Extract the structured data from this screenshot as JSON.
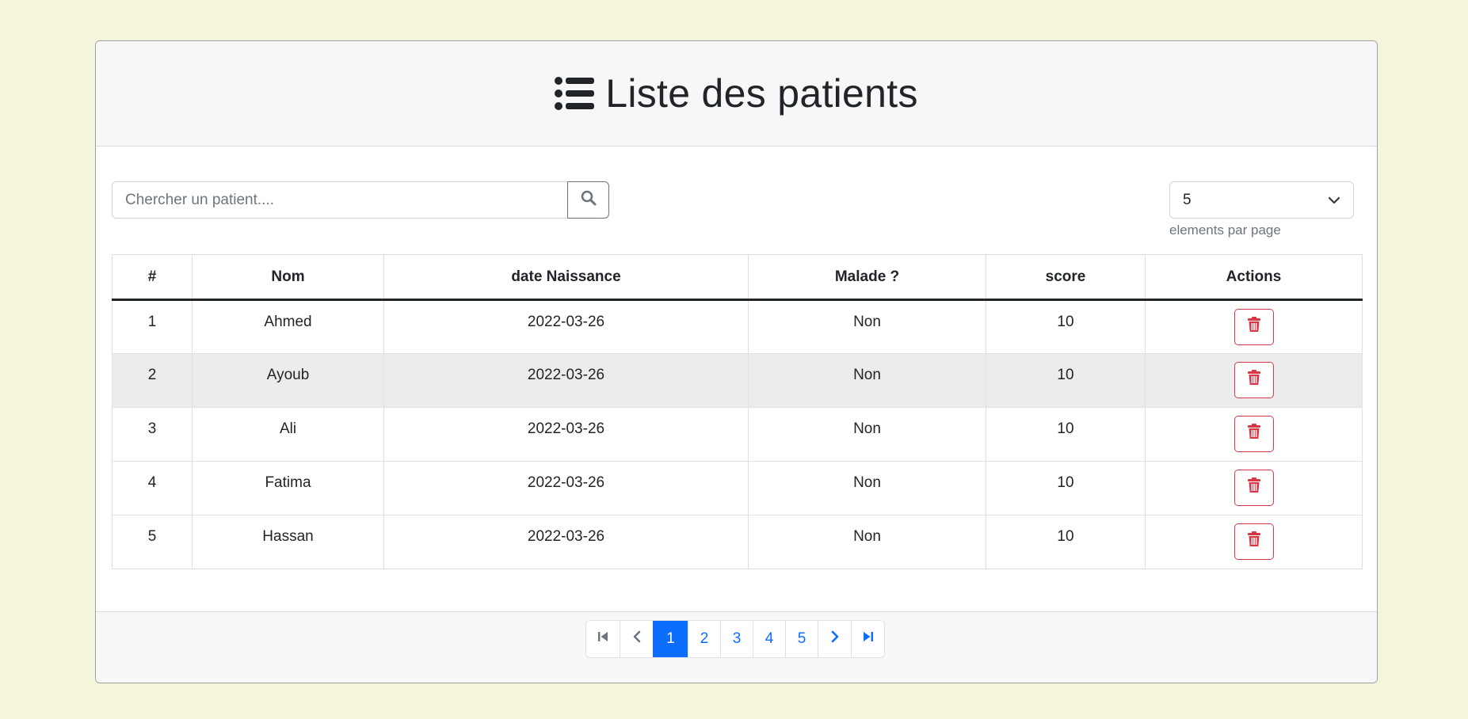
{
  "header": {
    "title": "Liste des patients",
    "icon": "list-icon"
  },
  "search": {
    "placeholder": "Chercher un patient....",
    "button_icon": "search-icon"
  },
  "page_size": {
    "selected": "5",
    "caption": "elements par page",
    "icon": "chevron-down-icon"
  },
  "table": {
    "columns": [
      "#",
      "Nom",
      "date Naissance",
      "Malade ?",
      "score",
      "Actions"
    ],
    "rows": [
      {
        "id": "1",
        "nom": "Ahmed",
        "date": "2022-03-26",
        "malade": "Non",
        "score": "10"
      },
      {
        "id": "2",
        "nom": "Ayoub",
        "date": "2022-03-26",
        "malade": "Non",
        "score": "10"
      },
      {
        "id": "3",
        "nom": "Ali",
        "date": "2022-03-26",
        "malade": "Non",
        "score": "10"
      },
      {
        "id": "4",
        "nom": "Fatima",
        "date": "2022-03-26",
        "malade": "Non",
        "score": "10"
      },
      {
        "id": "5",
        "nom": "Hassan",
        "date": "2022-03-26",
        "malade": "Non",
        "score": "10"
      }
    ],
    "delete_icon": "trash-icon"
  },
  "pagination": {
    "pages": [
      "1",
      "2",
      "3",
      "4",
      "5"
    ],
    "active": "1",
    "first_icon": "first-page-icon",
    "prev_icon": "chevron-left-icon",
    "next_icon": "chevron-right-icon",
    "last_icon": "last-page-icon"
  },
  "colors": {
    "page_background": "#f5f5dc",
    "primary": "#0d6efd",
    "danger": "#dc3545",
    "header_background": "#f7f7f7"
  }
}
